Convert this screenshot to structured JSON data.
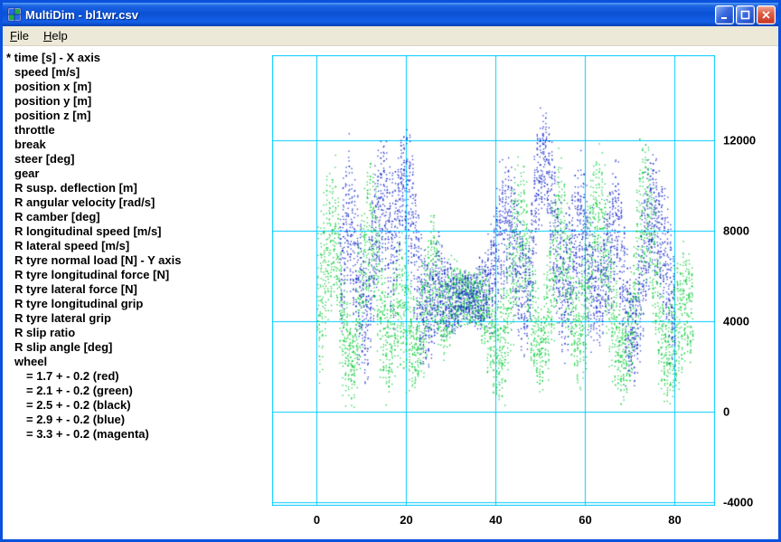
{
  "window": {
    "title": "MultiDim - bl1wr.csv"
  },
  "menu": {
    "items": [
      {
        "first": "F",
        "rest": "ile"
      },
      {
        "first": "H",
        "rest": "elp"
      }
    ]
  },
  "variables": [
    {
      "text": "* time [s] - X axis",
      "indent": 0
    },
    {
      "text": "speed [m/s]",
      "indent": 1
    },
    {
      "text": "position x [m]",
      "indent": 1
    },
    {
      "text": "position y [m]",
      "indent": 1
    },
    {
      "text": "position z [m]",
      "indent": 1
    },
    {
      "text": "throttle",
      "indent": 1
    },
    {
      "text": "break",
      "indent": 1
    },
    {
      "text": "steer [deg]",
      "indent": 1
    },
    {
      "text": "gear",
      "indent": 1
    },
    {
      "text": "R susp. deflection [m]",
      "indent": 1
    },
    {
      "text": "R angular velocity [rad/s]",
      "indent": 1
    },
    {
      "text": "R camber [deg]",
      "indent": 1
    },
    {
      "text": "R longitudinal speed [m/s]",
      "indent": 1
    },
    {
      "text": "R lateral speed [m/s]",
      "indent": 1
    },
    {
      "text": "R tyre normal load [N] - Y axis",
      "indent": 1
    },
    {
      "text": "R tyre longitudinal force [N]",
      "indent": 1
    },
    {
      "text": "R tyre lateral force [N]",
      "indent": 1
    },
    {
      "text": "R tyre longitudinal grip",
      "indent": 1
    },
    {
      "text": "R tyre lateral grip",
      "indent": 1
    },
    {
      "text": "R slip ratio",
      "indent": 1
    },
    {
      "text": "R slip angle [deg]",
      "indent": 1
    },
    {
      "text": "wheel",
      "indent": 1
    },
    {
      "text": "= 1.7 + - 0.2 (red)",
      "indent": 2
    },
    {
      "text": "= 2.1 + - 0.2 (green)",
      "indent": 2
    },
    {
      "text": "= 2.5 + - 0.2 (black)",
      "indent": 2
    },
    {
      "text": "= 2.9 + - 0.2 (blue)",
      "indent": 2
    },
    {
      "text": "= 3.3 + - 0.2 (magenta)",
      "indent": 2
    }
  ],
  "chart_data": {
    "type": "scatter",
    "title": "",
    "xlabel": "time [s]",
    "ylabel": "R tyre normal load [N]",
    "xlim": [
      -10,
      89
    ],
    "ylim": [
      -4160,
      15760
    ],
    "x_ticks": [
      0,
      20,
      40,
      60,
      80
    ],
    "y_ticks": [
      12000,
      8000,
      4000,
      0,
      -4000
    ],
    "grid": true,
    "grid_color": "#00ccff",
    "background": "#ffffff",
    "legend_position": "none",
    "note": "Dense noisy scatter; each series described by [time, mid-value, half-spread] envelope triples in data units",
    "series": [
      {
        "name": "wheel = 2.1 + - 0.2 (green)",
        "color": "#00cc33",
        "phase": 0,
        "density": 60,
        "envelope": [
          [
            0,
            4000,
            3000
          ],
          [
            2,
            7000,
            3000
          ],
          [
            4,
            8000,
            2600
          ],
          [
            6,
            3200,
            2400
          ],
          [
            8,
            2000,
            1700
          ],
          [
            10,
            6000,
            3000
          ],
          [
            12,
            8500,
            2600
          ],
          [
            14,
            5000,
            3000
          ],
          [
            16,
            2600,
            2000
          ],
          [
            18,
            5200,
            2600
          ],
          [
            20,
            4200,
            2600
          ],
          [
            22,
            2600,
            1600
          ],
          [
            24,
            4500,
            2400
          ],
          [
            26,
            6500,
            2400
          ],
          [
            28,
            4200,
            2000
          ],
          [
            30,
            5000,
            1600
          ],
          [
            32,
            5200,
            1200
          ],
          [
            34,
            5000,
            1000
          ],
          [
            36,
            5000,
            1100
          ],
          [
            38,
            4200,
            2000
          ],
          [
            40,
            2600,
            1800
          ],
          [
            42,
            3600,
            2600
          ],
          [
            44,
            7000,
            3000
          ],
          [
            46,
            8400,
            2600
          ],
          [
            48,
            4200,
            2600
          ],
          [
            50,
            2600,
            1600
          ],
          [
            52,
            5200,
            3000
          ],
          [
            54,
            8400,
            3000
          ],
          [
            56,
            6000,
            2600
          ],
          [
            58,
            3200,
            2000
          ],
          [
            60,
            5000,
            3000
          ],
          [
            62,
            9000,
            2600
          ],
          [
            64,
            8000,
            3000
          ],
          [
            66,
            4200,
            2600
          ],
          [
            68,
            2200,
            1600
          ],
          [
            70,
            3200,
            2000
          ],
          [
            72,
            8000,
            3400
          ],
          [
            74,
            9000,
            2600
          ],
          [
            76,
            5000,
            3000
          ],
          [
            78,
            2200,
            1600
          ],
          [
            80,
            3600,
            2600
          ],
          [
            82,
            5000,
            2400
          ],
          [
            84,
            4200,
            2000
          ]
        ]
      },
      {
        "name": "wheel = 2.9 + - 0.2 (blue)",
        "color": "#1122cc",
        "phase": 2.1,
        "density": 60,
        "envelope": [
          [
            5,
            6000,
            2600
          ],
          [
            7,
            9000,
            2600
          ],
          [
            9,
            6000,
            3000
          ],
          [
            11,
            3600,
            2600
          ],
          [
            13,
            8000,
            3000
          ],
          [
            15,
            9400,
            2600
          ],
          [
            17,
            7000,
            3000
          ],
          [
            19,
            10400,
            2000
          ],
          [
            21,
            9000,
            3000
          ],
          [
            23,
            5000,
            2600
          ],
          [
            25,
            4200,
            2000
          ],
          [
            27,
            5600,
            2000
          ],
          [
            29,
            5000,
            1600
          ],
          [
            31,
            4800,
            1200
          ],
          [
            33,
            5200,
            1000
          ],
          [
            35,
            5000,
            1100
          ],
          [
            37,
            5200,
            1600
          ],
          [
            39,
            6000,
            2000
          ],
          [
            41,
            8000,
            2600
          ],
          [
            43,
            8600,
            2600
          ],
          [
            45,
            6000,
            2600
          ],
          [
            47,
            5000,
            2000
          ],
          [
            49,
            10000,
            2400
          ],
          [
            51,
            11400,
            1800
          ],
          [
            53,
            8000,
            3000
          ],
          [
            55,
            5000,
            2600
          ],
          [
            57,
            7000,
            2600
          ],
          [
            59,
            8600,
            2600
          ],
          [
            61,
            6000,
            2600
          ],
          [
            63,
            5000,
            2000
          ],
          [
            65,
            7000,
            2600
          ],
          [
            67,
            8600,
            2600
          ],
          [
            69,
            4600,
            2600
          ],
          [
            71,
            3200,
            2000
          ],
          [
            73,
            7000,
            3000
          ],
          [
            75,
            9200,
            2600
          ],
          [
            77,
            7600,
            2600
          ],
          [
            79,
            5200,
            2600
          ],
          [
            80,
            4200,
            2000
          ]
        ]
      }
    ]
  }
}
